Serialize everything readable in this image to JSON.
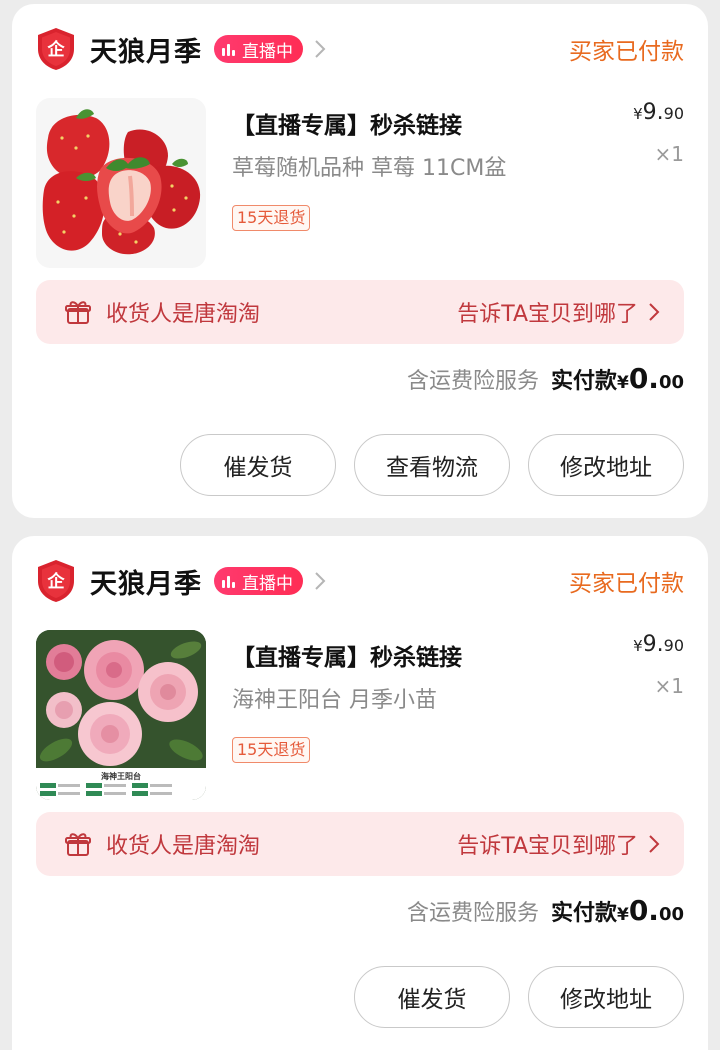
{
  "colors": {
    "accent_red": "#ff2d55",
    "status_orange": "#e86a1f",
    "gift_bar_bg": "#fde9ea",
    "gift_text": "#c0383d"
  },
  "orders": [
    {
      "shop_name": "天狼月季",
      "shop_icon": "enterprise-shield-icon",
      "live_label": "直播中",
      "status": "买家已付款",
      "product_title": "【直播专属】秒杀链接",
      "product_spec": "草莓随机品种 草莓 11CM盆",
      "product_image": "strawberries-image",
      "return_badge": "15天退货",
      "price_currency": "¥",
      "price_int": "9.",
      "price_dec": "90",
      "quantity": "×1",
      "receiver_text": "收货人是唐淘淘",
      "tell_link": "告诉TA宝贝到哪了",
      "insurance_text": "含运费险服务",
      "paid_label": "实付款",
      "paid_currency": "¥",
      "paid_int": "0.",
      "paid_dec": "00",
      "buttons": [
        "催发货",
        "查看物流",
        "修改地址"
      ]
    },
    {
      "shop_name": "天狼月季",
      "shop_icon": "enterprise-shield-icon",
      "live_label": "直播中",
      "status": "买家已付款",
      "product_title": "【直播专属】秒杀链接",
      "product_spec": "海神王阳台 月季小苗",
      "product_image": "pink-rose-image",
      "product_image_caption": "海神王阳台",
      "return_badge": "15天退货",
      "price_currency": "¥",
      "price_int": "9.",
      "price_dec": "90",
      "quantity": "×1",
      "receiver_text": "收货人是唐淘淘",
      "tell_link": "告诉TA宝贝到哪了",
      "insurance_text": "含运费险服务",
      "paid_label": "实付款",
      "paid_currency": "¥",
      "paid_int": "0.",
      "paid_dec": "00",
      "buttons": [
        "催发货",
        "修改地址"
      ]
    }
  ]
}
